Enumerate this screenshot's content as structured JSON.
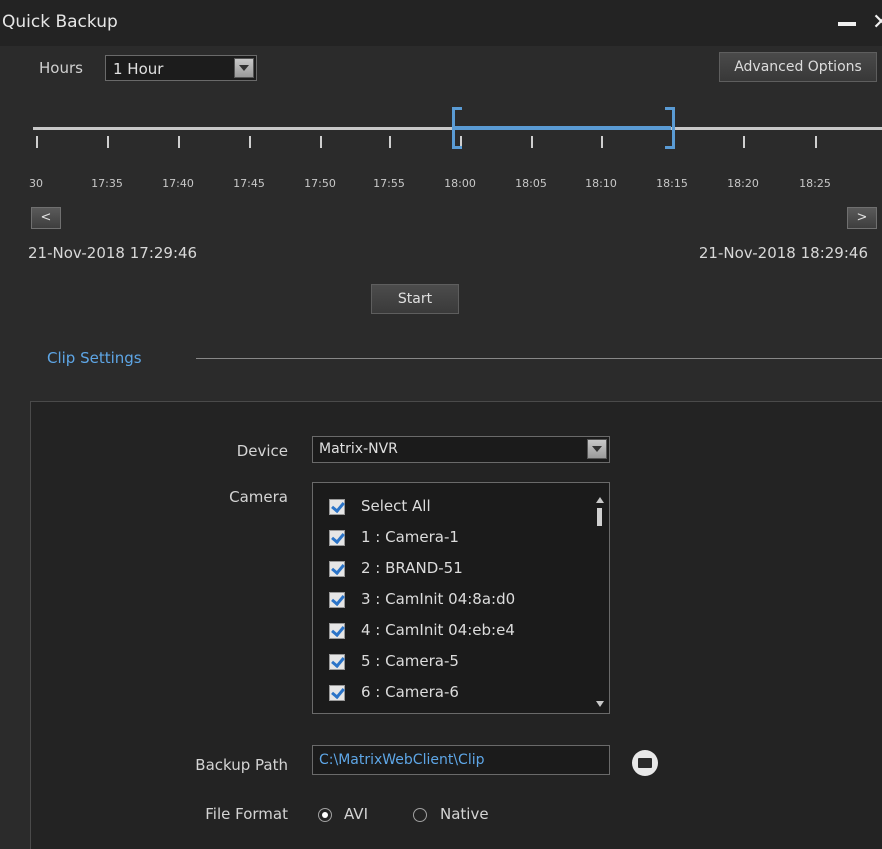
{
  "window": {
    "title": "Quick Backup",
    "minimize_icon": "minimize-icon",
    "close_icon": "close-icon",
    "close_glyph": "✕"
  },
  "toolbar": {
    "hours_label": "Hours",
    "hours_value": "1 Hour",
    "advanced_label": "Advanced Options"
  },
  "timeline": {
    "tick_labels": [
      "30",
      "17:35",
      "17:40",
      "17:45",
      "17:50",
      "17:55",
      "18:00",
      "18:05",
      "18:10",
      "18:15",
      "18:20",
      "18:25"
    ],
    "prev_label": "<",
    "next_label": ">",
    "start_date": "21-Nov-2018 17:29:46",
    "end_date": "21-Nov-2018 18:29:46",
    "selection_color": "#5a9bd4"
  },
  "actions": {
    "start_label": "Start"
  },
  "clip_settings": {
    "title": "Clip Settings",
    "device_label": "Device",
    "device_value": "Matrix-NVR",
    "camera_label": "Camera",
    "cameras": [
      {
        "label": "Select All",
        "checked": true
      },
      {
        "label": "1 : Camera-1",
        "checked": true
      },
      {
        "label": "2 : BRAND-51",
        "checked": true
      },
      {
        "label": "3 : CamInit 04:8a:d0",
        "checked": true
      },
      {
        "label": "4 : CamInit 04:eb:e4",
        "checked": true
      },
      {
        "label": "5 : Camera-5",
        "checked": true
      },
      {
        "label": "6 : Camera-6",
        "checked": true
      }
    ],
    "backup_path_label": "Backup Path",
    "backup_path_value": "C:\\MatrixWebClient\\Clip",
    "file_format_label": "File Format",
    "format_options": [
      {
        "label": "AVI",
        "selected": true
      },
      {
        "label": "Native",
        "selected": false
      }
    ]
  }
}
